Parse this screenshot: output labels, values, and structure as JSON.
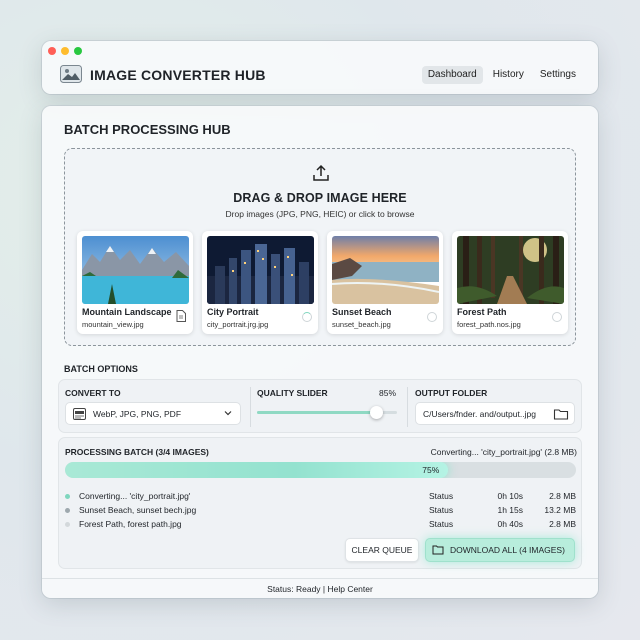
{
  "app": {
    "title": "IMAGE CONVERTER HUB",
    "nav": [
      "Dashboard",
      "History",
      "Settings"
    ],
    "active_tab": "Dashboard",
    "logo_icon": "image-landscape-icon"
  },
  "hub": {
    "title": "BATCH PROCESSING HUB",
    "dropzone": {
      "icon": "upload-icon",
      "title": "DRAG & DROP IMAGE HERE",
      "subtitle": "Drop images (JPG, PNG, HEIC) or click to browse"
    },
    "images": [
      {
        "name": "Mountain Landscape",
        "file": "mountain_view.jpg",
        "state": "done"
      },
      {
        "name": "City Portrait",
        "file": "city_portrait.jrg.jpg",
        "state": "processing"
      },
      {
        "name": "Sunset Beach",
        "file": "sunset_beach.jpg",
        "state": "queued"
      },
      {
        "name": "Forest Path",
        "file": "forest_path.nos.jpg",
        "state": "queued"
      }
    ]
  },
  "options": {
    "label": "BATCH OPTIONS",
    "convert_to": {
      "label": "CONVERT TO",
      "value": "WebP, JPG, PNG, PDF"
    },
    "quality": {
      "label": "QUALITY SLIDER",
      "value_text": "85%",
      "value": 0.85
    },
    "output_folder": {
      "label": "OUTPUT FOLDER",
      "path": "C/Users/fnder. and/output..jpg"
    }
  },
  "processing": {
    "title": "PROCESSING BATCH (3/4 IMAGES)",
    "current": "Converting... 'city_portrait.jpg' (2.8 MB)",
    "progress_text": "75%",
    "progress": 0.75,
    "rows": [
      {
        "name": "Converting... 'city_portrait.jpg'",
        "status": "Status",
        "time": "0h 10s",
        "size": "2.8 MB",
        "dot": "#7fd6be"
      },
      {
        "name": "Sunset Beach, sunset bech.jpg",
        "status": "Status",
        "time": "1h 15s",
        "size": "13.2 MB",
        "dot": "#9ea8ae"
      },
      {
        "name": "Forest Path, forest path.jpg",
        "status": "Status",
        "time": "0h 40s",
        "size": "2.8 MB",
        "dot": "#d3d8db"
      }
    ],
    "clear_label": "CLEAR QUEUE",
    "download_label": "DOWNLOAD ALL (4 IMAGES)"
  },
  "footer": {
    "text": "Status: Ready | Help Center"
  },
  "colors": {
    "accent": "#93e2cf",
    "accent_border": "#9fe1cc"
  }
}
